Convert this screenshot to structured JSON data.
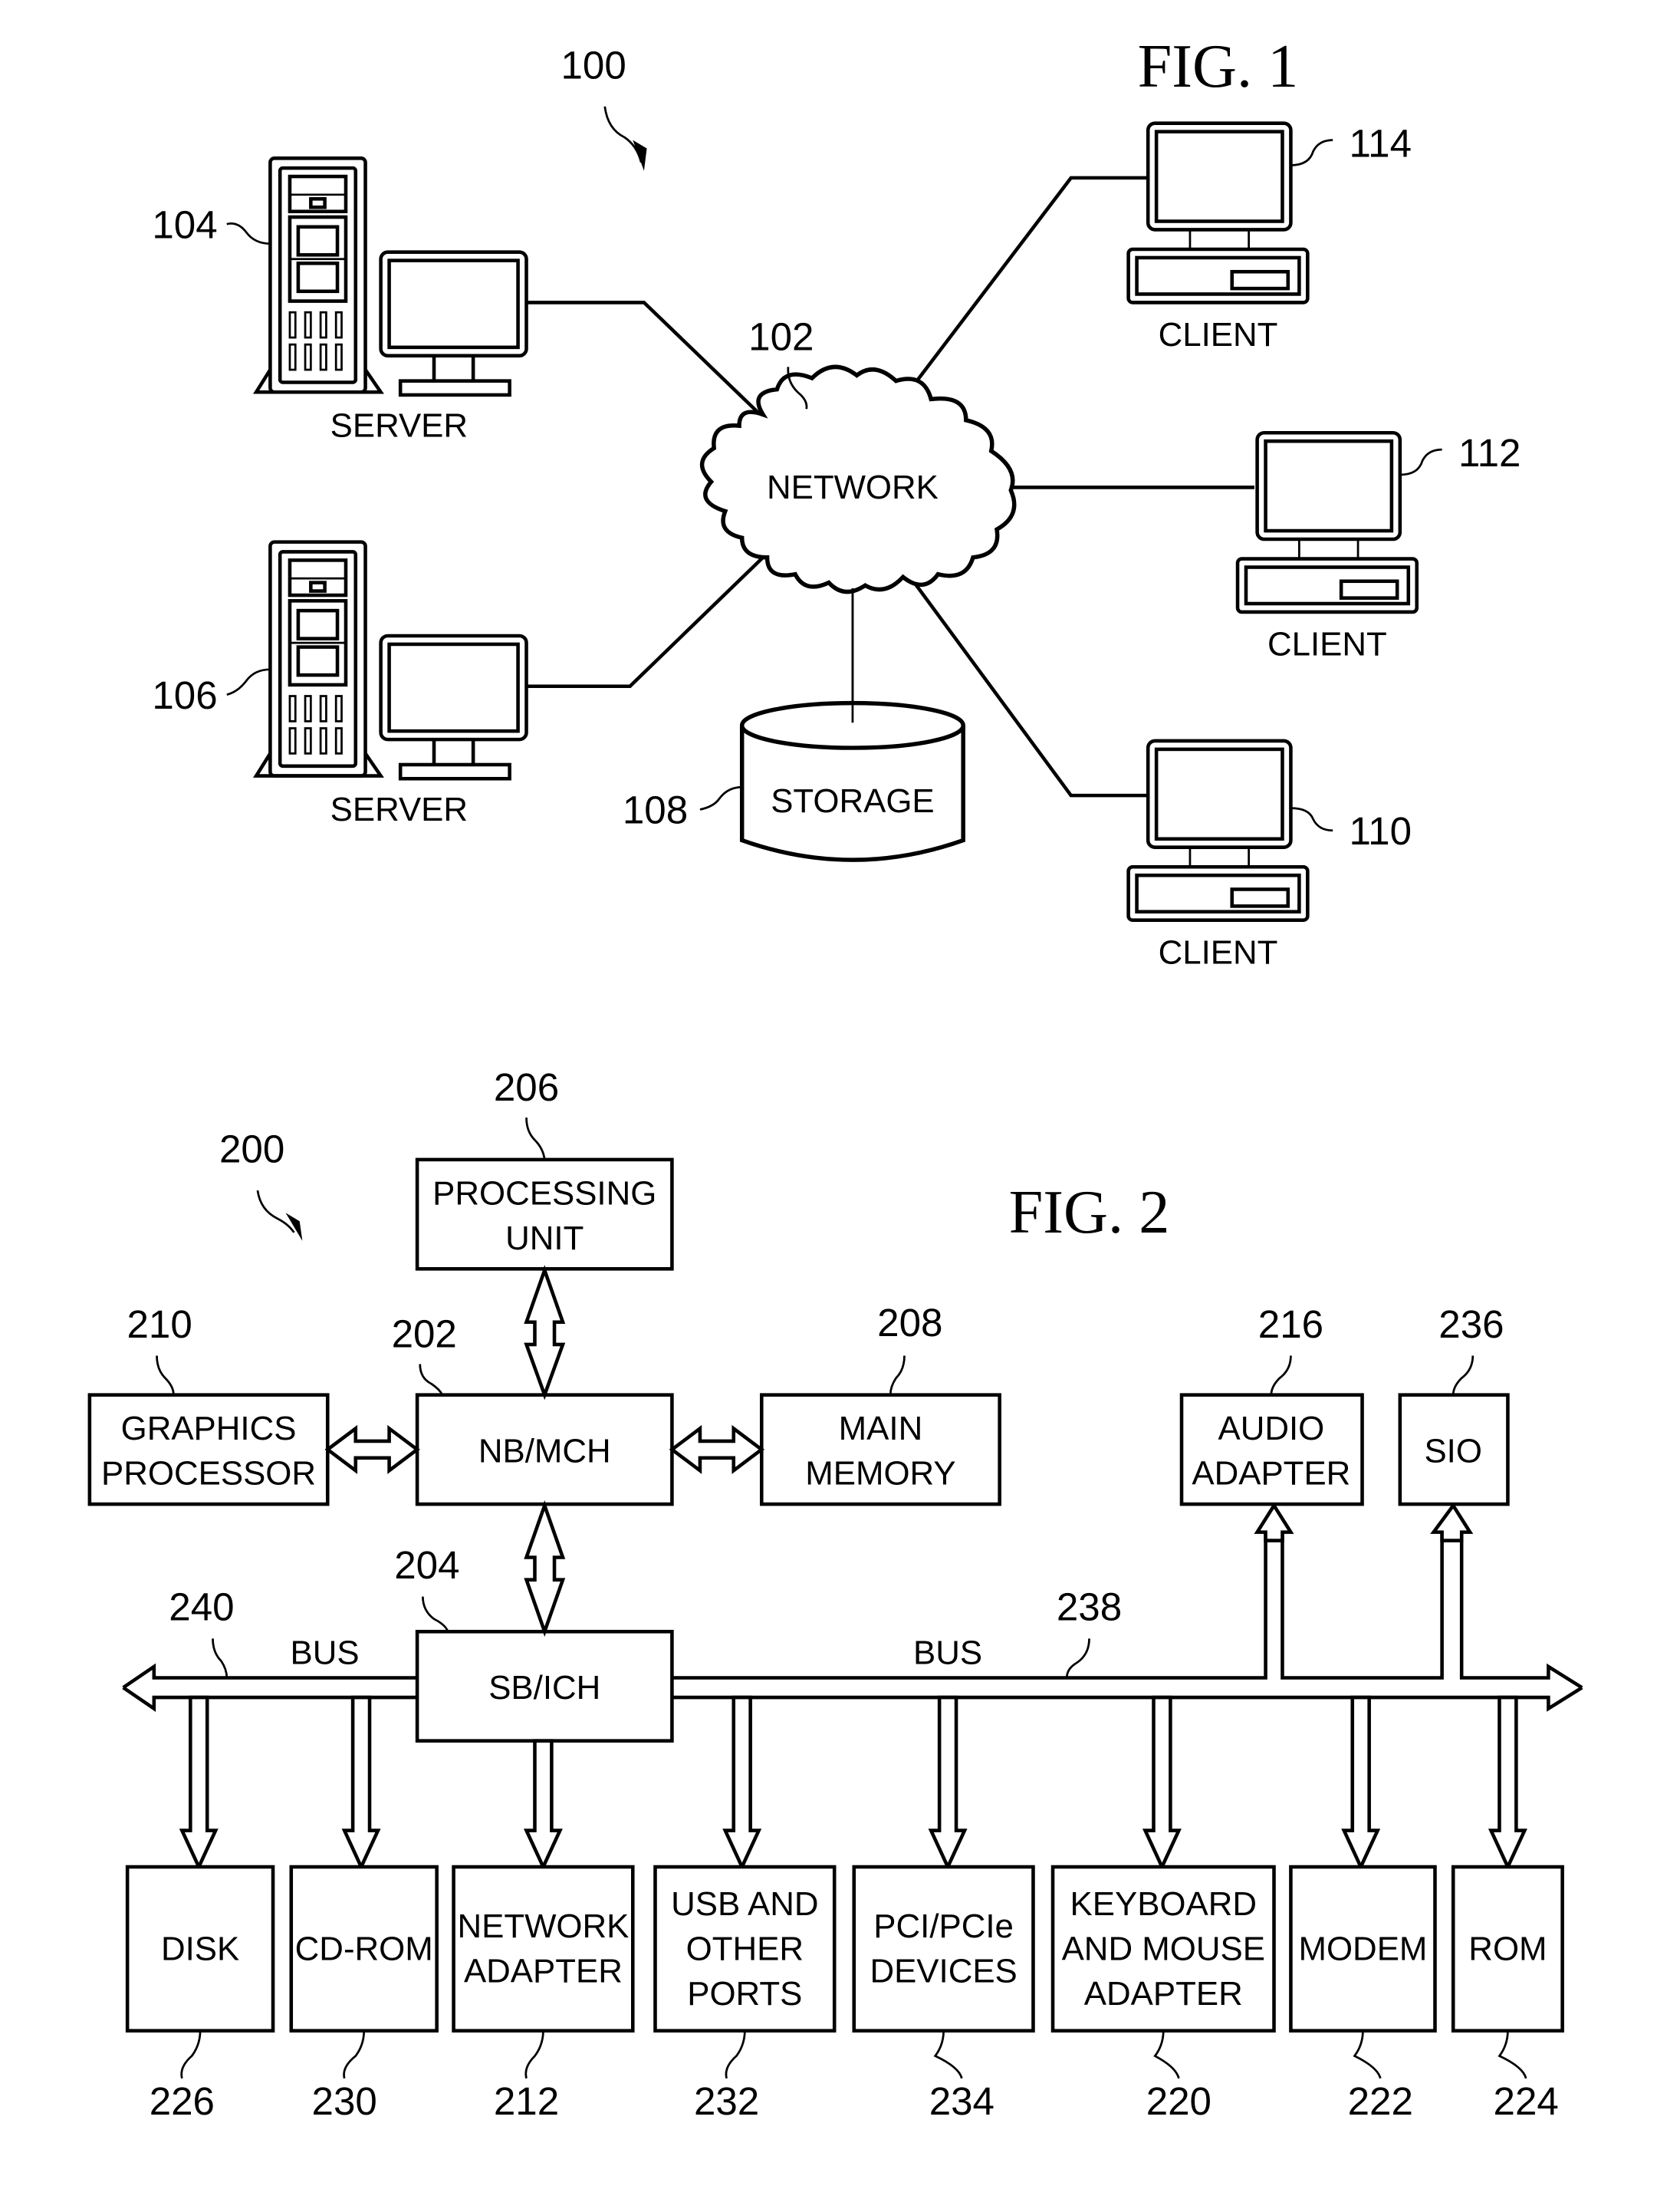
{
  "fig1": {
    "title": "FIG. 1",
    "system_ref": "100",
    "network": {
      "label": "NETWORK",
      "ref": "102"
    },
    "storage": {
      "label": "STORAGE",
      "ref": "108"
    },
    "servers": [
      {
        "label": "SERVER",
        "ref": "104"
      },
      {
        "label": "SERVER",
        "ref": "106"
      }
    ],
    "clients": [
      {
        "label": "CLIENT",
        "ref": "114"
      },
      {
        "label": "CLIENT",
        "ref": "112"
      },
      {
        "label": "CLIENT",
        "ref": "110"
      }
    ]
  },
  "fig2": {
    "title": "FIG. 2",
    "system_ref": "200",
    "processing_unit": {
      "line1": "PROCESSING",
      "line2": "UNIT",
      "ref": "206"
    },
    "nb_mch": {
      "label": "NB/MCH",
      "ref": "202"
    },
    "graphics_processor": {
      "line1": "GRAPHICS",
      "line2": "PROCESSOR",
      "ref": "210"
    },
    "main_memory": {
      "line1": "MAIN",
      "line2": "MEMORY",
      "ref": "208"
    },
    "sb_ich": {
      "label": "SB/ICH",
      "ref": "204"
    },
    "audio_adapter": {
      "line1": "AUDIO",
      "line2": "ADAPTER",
      "ref": "216"
    },
    "sio": {
      "label": "SIO",
      "ref": "236"
    },
    "bus_left": {
      "label": "BUS",
      "ref": "240"
    },
    "bus_right": {
      "label": "BUS",
      "ref": "238"
    },
    "devices": [
      {
        "lines": [
          "DISK"
        ],
        "ref": "226"
      },
      {
        "lines": [
          "CD-ROM"
        ],
        "ref": "230"
      },
      {
        "lines": [
          "NETWORK",
          "ADAPTER"
        ],
        "ref": "212"
      },
      {
        "lines": [
          "USB AND",
          "OTHER",
          "PORTS"
        ],
        "ref": "232"
      },
      {
        "lines": [
          "PCI/PCIe",
          "DEVICES"
        ],
        "ref": "234"
      },
      {
        "lines": [
          "KEYBOARD",
          "AND MOUSE",
          "ADAPTER"
        ],
        "ref": "220"
      },
      {
        "lines": [
          "MODEM"
        ],
        "ref": "222"
      },
      {
        "lines": [
          "ROM"
        ],
        "ref": "224"
      }
    ]
  }
}
